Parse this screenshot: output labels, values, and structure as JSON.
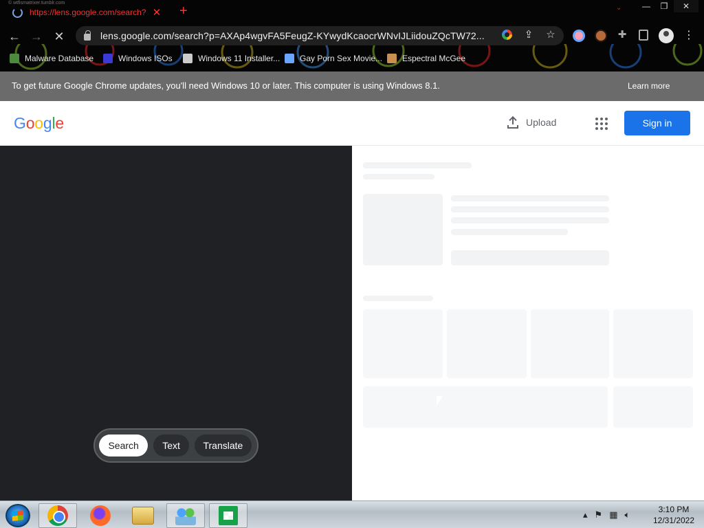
{
  "browser": {
    "tab": {
      "title": "https://lens.google.com/search?p",
      "close_icon": "close-icon"
    },
    "tiny_caption": "©  wtfismatrixer.tumblr.com",
    "new_tab_icon": "plus-icon",
    "address": "lens.google.com/search?p=AXAp4wgvFA5FeugZ-KYwydKcaocrWNvIJLiidouZQcTW72...",
    "toolbar_icons": [
      "back-arrow-icon",
      "forward-arrow-icon",
      "reload-icon",
      "share-icon",
      "star-icon",
      "puzzle-icon",
      "side-panel-icon",
      "profile-icon",
      "more-icon"
    ],
    "bookmarks": [
      {
        "label": "Malware Database",
        "icon": "malware-icon",
        "color": "#4b8b3b"
      },
      {
        "label": "Windows ISOs",
        "icon": "x-icon",
        "color": "#3a3ad6"
      },
      {
        "label": "Windows 11 Installer...",
        "icon": "installer-icon",
        "color": "#cccccc"
      },
      {
        "label": "Gay Porn Sex Movie...",
        "icon": "movie-icon",
        "color": "#6aa5ff"
      },
      {
        "label": "Espectral McGee",
        "icon": "spectral-icon",
        "color": "#c88f50"
      }
    ],
    "window_controls": {
      "minimize": "—",
      "maximize": "❐",
      "close": "✕"
    }
  },
  "infobar": {
    "message": "To get future Google Chrome updates, you'll need Windows 10 or later. This computer is using Windows 8.1.",
    "link": "Learn more",
    "close_icon": "close-icon"
  },
  "lens": {
    "logo": [
      "G",
      "o",
      "o",
      "g",
      "l",
      "e"
    ],
    "logo_colors": [
      "#4285f4",
      "#ea4335",
      "#fbbc05",
      "#4285f4",
      "#34a853",
      "#ea4335"
    ],
    "upload_label": "Upload",
    "apps_icon": "apps-grid-icon",
    "sign_in_label": "Sign in",
    "modes": [
      "Search",
      "Text",
      "Translate"
    ],
    "active_mode": "Search"
  },
  "taskbar": {
    "apps": [
      "start-button",
      "chrome-icon",
      "firefox-icon",
      "file-explorer-icon",
      "people-icon",
      "store-icon"
    ],
    "tray_icons": [
      "chevron-up-icon",
      "flag-icon",
      "network-icon",
      "volume-icon"
    ],
    "time": "3:10 PM",
    "date": "12/31/2022"
  }
}
